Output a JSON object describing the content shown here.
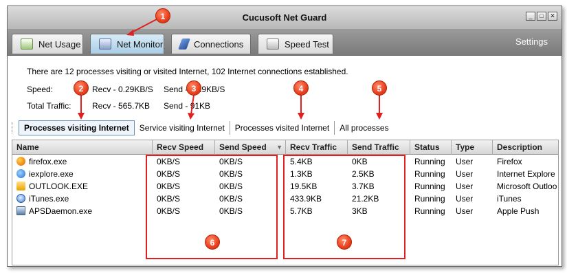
{
  "window": {
    "title": "Cucusoft Net Guard",
    "controls": [
      "_",
      "□",
      "✕"
    ]
  },
  "tabs": [
    {
      "label": "Net Usage",
      "icon": "net-usage-icon"
    },
    {
      "label": "Net Monitor",
      "icon": "net-monitor-icon",
      "active": true
    },
    {
      "label": "Connections",
      "icon": "connections-icon"
    },
    {
      "label": "Speed Test",
      "icon": "speed-test-icon"
    }
  ],
  "settings_label": "Settings",
  "summary": {
    "text": "There are 12 processes visiting or visited Internet, 102 Internet connections established.",
    "speed_label": "Speed:",
    "speed_recv": "Recv -  0.29KB/S",
    "speed_send": "Send - 0.29KB/S",
    "traffic_label": "Total Traffic:",
    "traffic_recv": "Recv -  565.7KB",
    "traffic_send": "Send - 91KB"
  },
  "filters": [
    "Processes visiting Internet",
    "Service visiting Internet",
    "Processes visited Internet",
    "All processes"
  ],
  "columns": [
    "Name",
    "Recv Speed",
    "Send Speed",
    "Recv Traffic",
    "Send Traffic",
    "Status",
    "Type",
    "Description"
  ],
  "rows": [
    {
      "name": "firefox.exe",
      "recv_speed": "0KB/S",
      "send_speed": "0KB/S",
      "recv_traffic": "5.4KB",
      "send_traffic": "0KB",
      "status": "Running",
      "type": "User",
      "description": "Firefox",
      "icon": "firefox-icon",
      "color": "#e66000"
    },
    {
      "name": "iexplore.exe",
      "recv_speed": "0KB/S",
      "send_speed": "0KB/S",
      "recv_traffic": "1.3KB",
      "send_traffic": "2.5KB",
      "status": "Running",
      "type": "User",
      "description": "Internet Explore",
      "icon": "internet-explorer-icon",
      "color": "#1e6fd0"
    },
    {
      "name": "OUTLOOK.EXE",
      "recv_speed": "0KB/S",
      "send_speed": "0KB/S",
      "recv_traffic": "19.5KB",
      "send_traffic": "3.7KB",
      "status": "Running",
      "type": "User",
      "description": "Microsoft Outloo",
      "icon": "outlook-icon",
      "color": "#e8a200"
    },
    {
      "name": "iTunes.exe",
      "recv_speed": "0KB/S",
      "send_speed": "0KB/S",
      "recv_traffic": "433.9KB",
      "send_traffic": "21.2KB",
      "status": "Running",
      "type": "User",
      "description": "iTunes",
      "icon": "itunes-icon",
      "color": "#3b7fd9"
    },
    {
      "name": "APSDaemon.exe",
      "recv_speed": "0KB/S",
      "send_speed": "0KB/S",
      "recv_traffic": "5.7KB",
      "send_traffic": "3KB",
      "status": "Running",
      "type": "User",
      "description": "Apple Push",
      "icon": "generic-app-icon",
      "color": "#5a7fa8"
    }
  ],
  "annotations": [
    "1",
    "2",
    "3",
    "4",
    "5",
    "6",
    "7"
  ],
  "colors": {
    "annotation_red": "#e02020",
    "active_tab": "#a9cde6"
  }
}
